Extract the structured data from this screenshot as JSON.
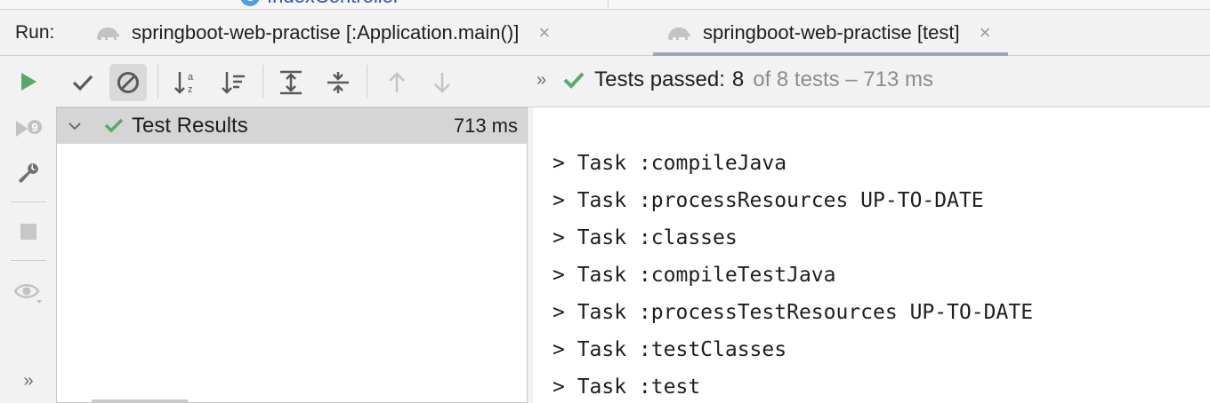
{
  "editor_tab": {
    "icon_letter": "C",
    "name": "IndexController"
  },
  "run_bar": {
    "label": "Run:",
    "tabs": [
      {
        "label": "springboot-web-practise [:Application.main()]",
        "close": "×",
        "active": false
      },
      {
        "label": "springboot-web-practise [test]",
        "close": "×",
        "active": true
      }
    ]
  },
  "left_toolbar": {
    "icons": [
      "run-icon",
      "rerun-failed-icon",
      "wrench-icon",
      "stop-icon",
      "eye-icon",
      "more-icon"
    ],
    "more_label": "»"
  },
  "toolbar": {
    "icons": [
      "check-icon",
      "ignored-icon",
      "sort-alpha-icon",
      "sort-duration-icon",
      "expand-all-icon",
      "collapse-all-icon",
      "arrow-up-icon",
      "arrow-down-icon"
    ],
    "more_label": "»"
  },
  "status": {
    "prefix": "Tests passed:",
    "passed": "8",
    "suffix": "of 8 tests – 713 ms",
    "color": "#59a869"
  },
  "tree": {
    "root_label": "Test Results",
    "root_time": "713 ms"
  },
  "console": {
    "lines": [
      "> Task :compileJava",
      "> Task :processResources UP-TO-DATE",
      "> Task :classes",
      "> Task :compileTestJava",
      "> Task :processTestResources UP-TO-DATE",
      "> Task :testClasses",
      "> Task :test"
    ]
  }
}
